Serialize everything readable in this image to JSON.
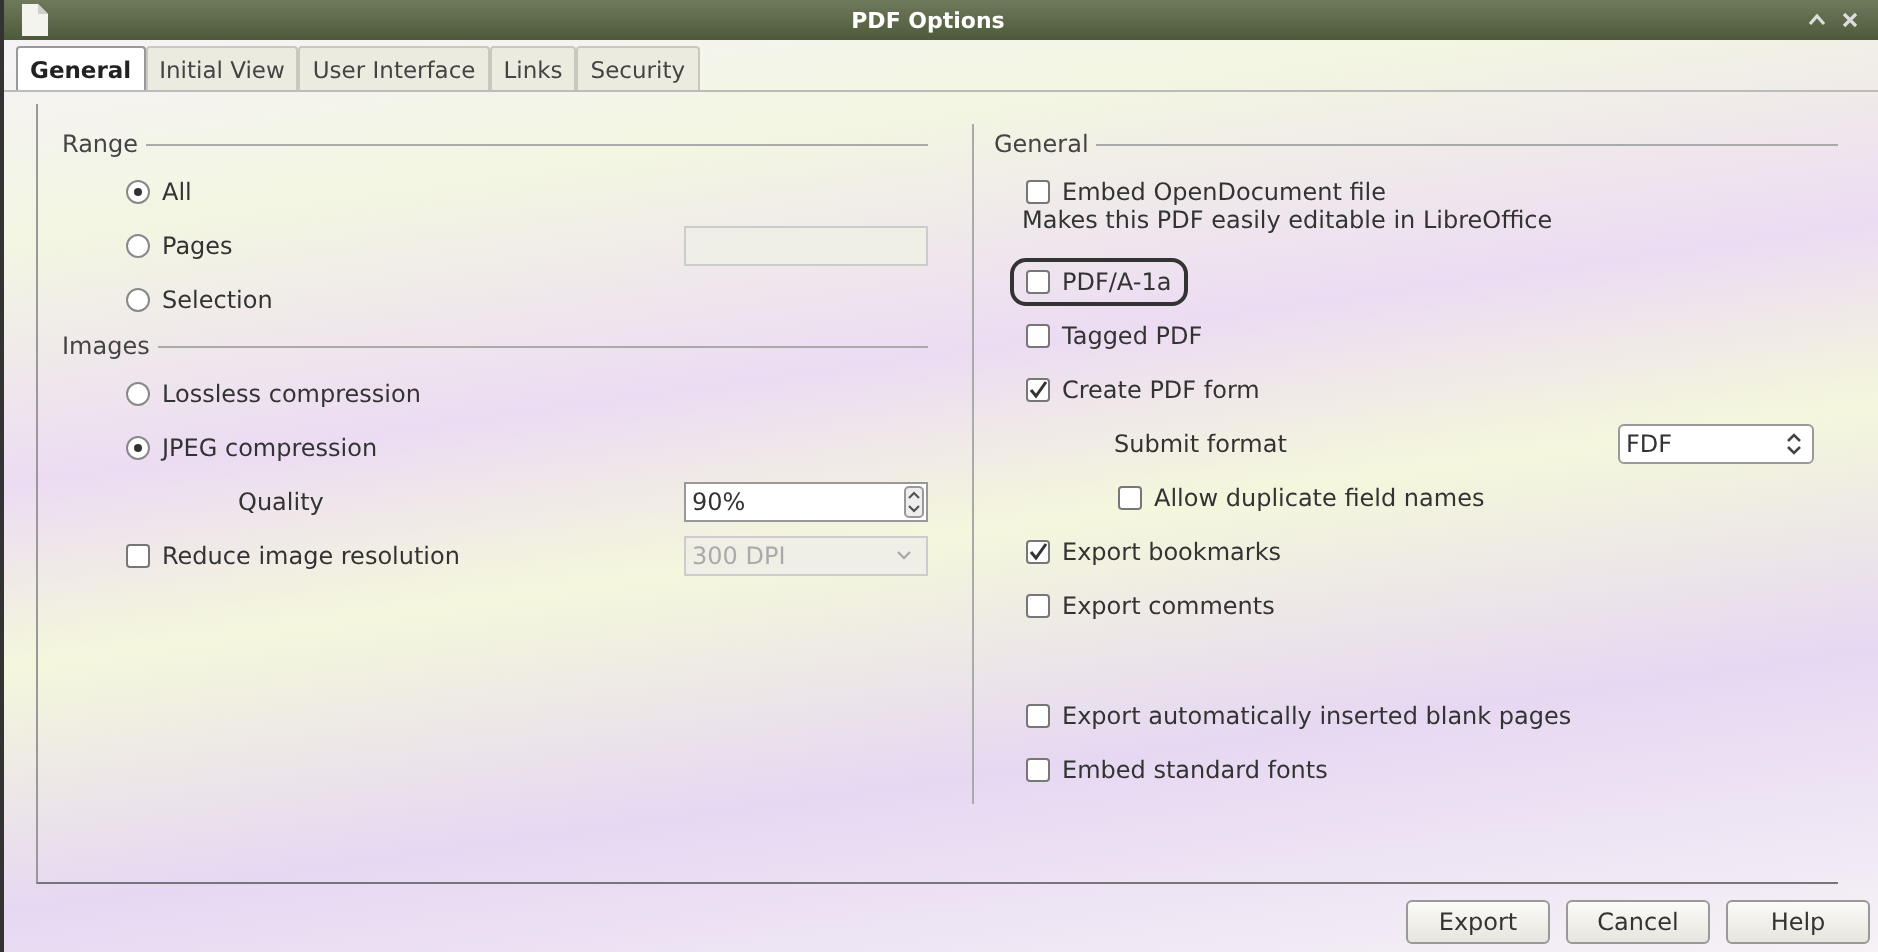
{
  "window": {
    "title": "PDF Options"
  },
  "tabs": [
    {
      "label": "General",
      "selected": true
    },
    {
      "label": "Initial View",
      "selected": false
    },
    {
      "label": "User Interface",
      "selected": false
    },
    {
      "label": "Links",
      "selected": false
    },
    {
      "label": "Security",
      "selected": false
    }
  ],
  "left": [
    {
      "title": "Range",
      "items": [
        {
          "kind": "radio",
          "label": "All",
          "selected": true
        },
        {
          "kind": "radio",
          "label": "Pages",
          "selected": false,
          "field": {
            "disabled": true
          }
        },
        {
          "kind": "radio",
          "label": "Selection",
          "selected": false
        }
      ]
    },
    {
      "title": "Images",
      "items": [
        {
          "kind": "radio",
          "label": "Lossless compression",
          "selected": false
        },
        {
          "kind": "radio",
          "label": "JPEG compression",
          "selected": true,
          "children": [
            {
              "kind": "spin",
              "label": "Quality",
              "value": "90%"
            }
          ]
        },
        {
          "kind": "checkbox",
          "label": "Reduce image resolution",
          "checked": false,
          "select": {
            "value": "300 DPI",
            "disabled": true
          }
        }
      ]
    }
  ],
  "right": {
    "title": "General",
    "items": [
      {
        "kind": "checkbox",
        "label": "Embed OpenDocument file",
        "checked": false,
        "highlighted": false,
        "note": "Makes this PDF easily editable in LibreOffice"
      },
      {
        "kind": "checkbox",
        "label": "PDF/A-1a",
        "checked": false,
        "highlighted": true
      },
      {
        "kind": "checkbox",
        "label": "Tagged PDF",
        "checked": false,
        "highlighted": false
      },
      {
        "kind": "checkbox",
        "label": "Create PDF form",
        "checked": true,
        "highlighted": false,
        "children": [
          {
            "kind": "select",
            "label": "Submit format",
            "value": "FDF"
          },
          {
            "kind": "checkbox",
            "label": "Allow duplicate field names",
            "checked": false
          }
        ]
      },
      {
        "kind": "checkbox",
        "label": "Export bookmarks",
        "checked": true,
        "highlighted": false
      },
      {
        "kind": "checkbox",
        "label": "Export comments",
        "checked": false,
        "highlighted": false
      }
    ],
    "more_items": [
      {
        "kind": "checkbox",
        "label": "Export automatically inserted blank pages",
        "checked": false
      },
      {
        "kind": "checkbox",
        "label": "Embed standard fonts",
        "checked": false
      }
    ]
  },
  "buttons": [
    "Export",
    "Cancel",
    "Help"
  ]
}
